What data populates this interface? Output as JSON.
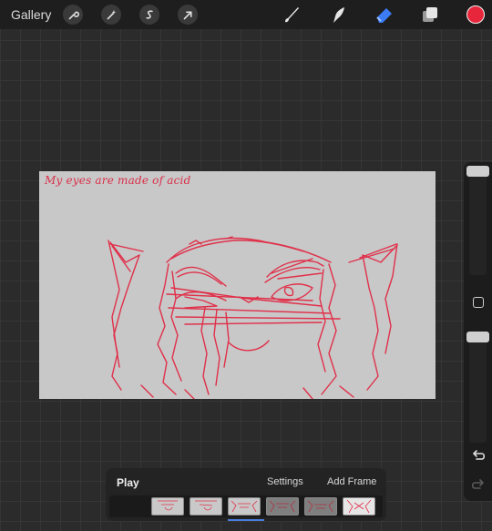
{
  "toolbar": {
    "gallery_label": "Gallery",
    "actions": [
      "wrench-icon",
      "magic-wand-icon",
      "selection-s-icon",
      "transform-arrow-icon"
    ],
    "tools": [
      "brush-icon",
      "smudge-icon",
      "eraser-icon",
      "layers-icon"
    ],
    "current_color": "#e8263b",
    "active_tool_color": "#3b7cf5"
  },
  "canvas": {
    "caption": "My eyes are made of acid",
    "background": "#c8c8c8",
    "stroke_color": "#e0304a"
  },
  "sidebar": {
    "icons": [
      "size-slider",
      "modifier-square-icon",
      "opacity-slider",
      "undo-icon",
      "redo-icon"
    ]
  },
  "animation": {
    "play_label": "Play",
    "settings_label": "Settings",
    "add_frame_label": "Add Frame",
    "frame_count": 6,
    "selected_frame": 3
  }
}
